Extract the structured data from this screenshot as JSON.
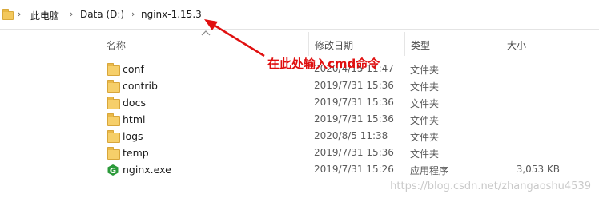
{
  "address_bar": {
    "crumbs": [
      "此电脑",
      "Data (D:)",
      "nginx-1.15.3"
    ],
    "separator": "›"
  },
  "columns": {
    "name": "名称",
    "modified": "修改日期",
    "type": "类型",
    "size": "大小"
  },
  "rows": [
    {
      "name": "conf",
      "modified": "2020/4/15 11:47",
      "type": "文件夹",
      "size": "",
      "icon": "folder-icon"
    },
    {
      "name": "contrib",
      "modified": "2019/7/31 15:36",
      "type": "文件夹",
      "size": "",
      "icon": "folder-icon"
    },
    {
      "name": "docs",
      "modified": "2019/7/31 15:36",
      "type": "文件夹",
      "size": "",
      "icon": "folder-icon"
    },
    {
      "name": "html",
      "modified": "2019/7/31 15:36",
      "type": "文件夹",
      "size": "",
      "icon": "folder-icon"
    },
    {
      "name": "logs",
      "modified": "2020/8/5 11:38",
      "type": "文件夹",
      "size": "",
      "icon": "folder-icon"
    },
    {
      "name": "temp",
      "modified": "2019/7/31 15:36",
      "type": "文件夹",
      "size": "",
      "icon": "folder-icon"
    },
    {
      "name": "nginx.exe",
      "modified": "2019/7/31 15:26",
      "type": "应用程序",
      "size": "3,053 KB",
      "icon": "nginx-app-icon"
    }
  ],
  "annotation": {
    "text": "在此处输入cmd命令",
    "color": "#e01010"
  },
  "watermark": "https://blog.csdn.net/zhangaoshu4539"
}
